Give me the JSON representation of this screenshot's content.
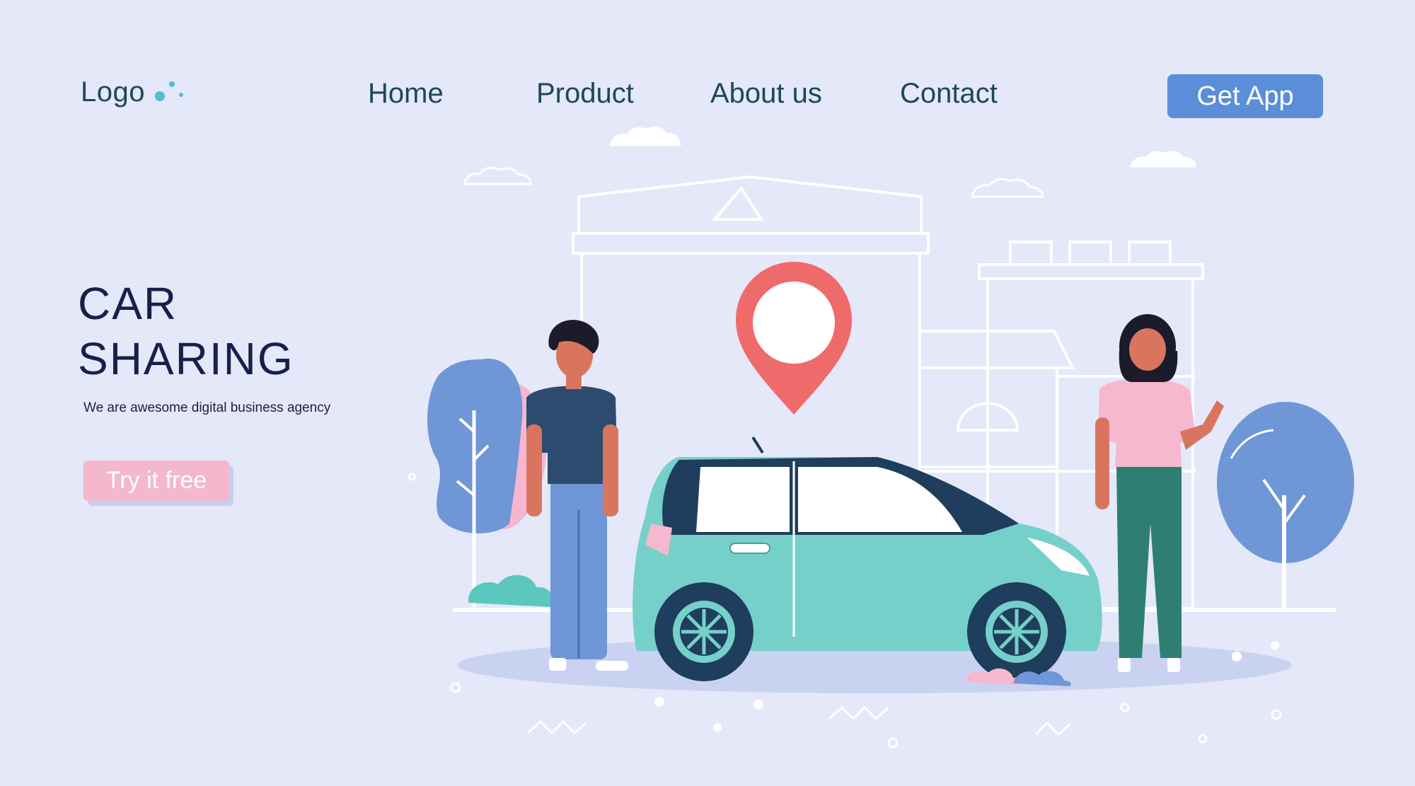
{
  "header": {
    "logo_text": "Logo",
    "nav": [
      "Home",
      "Product",
      "About us",
      "Contact"
    ],
    "cta_label": "Get App"
  },
  "hero": {
    "title_line1": "CAR",
    "title_line2": "SHARING",
    "subtitle": "We are awesome digital business agency",
    "button_label": "Try it free"
  },
  "colors": {
    "background": "#e4e8f8",
    "nav_text": "#1d4a52",
    "cta_button": "#5a8ed8",
    "hero_title": "#16204a",
    "try_button": "#f3b8cb",
    "location_pin": "#ef6a6a",
    "car_body": "#75d0c9"
  },
  "illustration": {
    "icons": [
      "location-pin-icon",
      "car-illustration",
      "man-illustration",
      "woman-illustration",
      "tree-icon",
      "building-outline"
    ]
  }
}
